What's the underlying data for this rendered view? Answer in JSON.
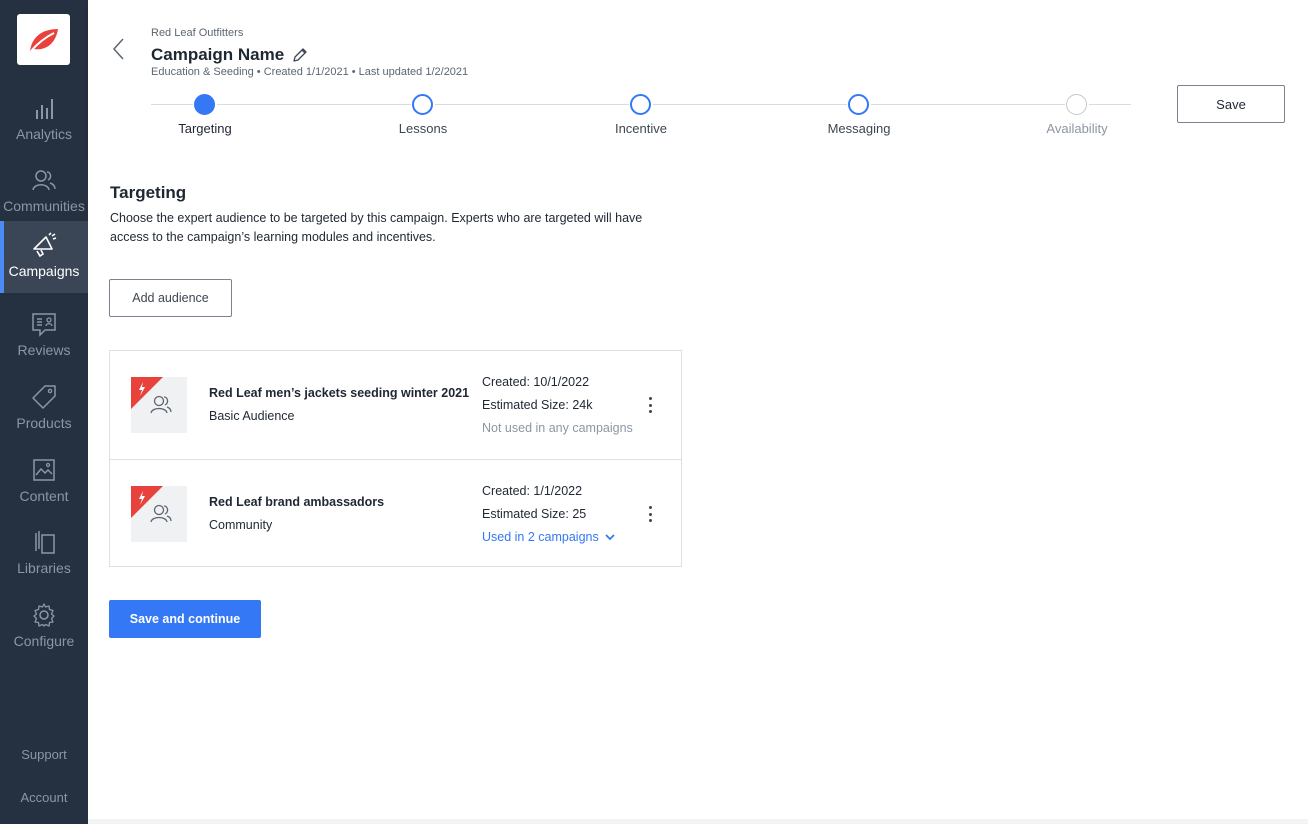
{
  "sidebar": {
    "items": [
      {
        "label": "Analytics",
        "icon": "bar-chart-icon"
      },
      {
        "label": "Communities",
        "icon": "people-icon"
      },
      {
        "label": "Campaigns",
        "icon": "megaphone-icon",
        "active": true
      },
      {
        "label": "Reviews",
        "icon": "review-icon"
      },
      {
        "label": "Products",
        "icon": "tag-icon"
      },
      {
        "label": "Content",
        "icon": "image-icon"
      },
      {
        "label": "Libraries",
        "icon": "library-icon"
      },
      {
        "label": "Configure",
        "icon": "gear-icon"
      }
    ],
    "support_label": "Support",
    "account_label": "Account"
  },
  "header": {
    "company": "Red Leaf Outfitters",
    "title": "Campaign Name",
    "meta": "Education & Seeding  •  Created 1/1/2021  •  Last updated 1/2/2021",
    "save_label": "Save",
    "steps": [
      {
        "label": "Targeting",
        "state": "current"
      },
      {
        "label": "Lessons",
        "state": "pending"
      },
      {
        "label": "Incentive",
        "state": "pending"
      },
      {
        "label": "Messaging",
        "state": "pending"
      },
      {
        "label": "Availability",
        "state": "disabled"
      }
    ]
  },
  "main": {
    "title": "Targeting",
    "description": "Choose the expert audience to be targeted by this campaign. Experts who are targeted will have access to the campaign’s learning modules and incentives.",
    "add_audience_label": "Add audience",
    "audiences": [
      {
        "name": "Red Leaf men’s jackets seeding winter 2021",
        "type": "Basic Audience",
        "created": "Created: 10/1/2022",
        "size": "Estimated Size: 24k",
        "usage": "Not used in any campaigns"
      },
      {
        "name": "Red Leaf brand ambassadors",
        "type": "Community",
        "created": "Created: 1/1/2022",
        "size": "Estimated Size: 25",
        "usage": "Used in 2 campaigns"
      }
    ],
    "save_continue_label": "Save and continue"
  },
  "colors": {
    "sidebar_bg": "#253040",
    "accent": "#3478f6",
    "brand_red": "#e8423c"
  }
}
